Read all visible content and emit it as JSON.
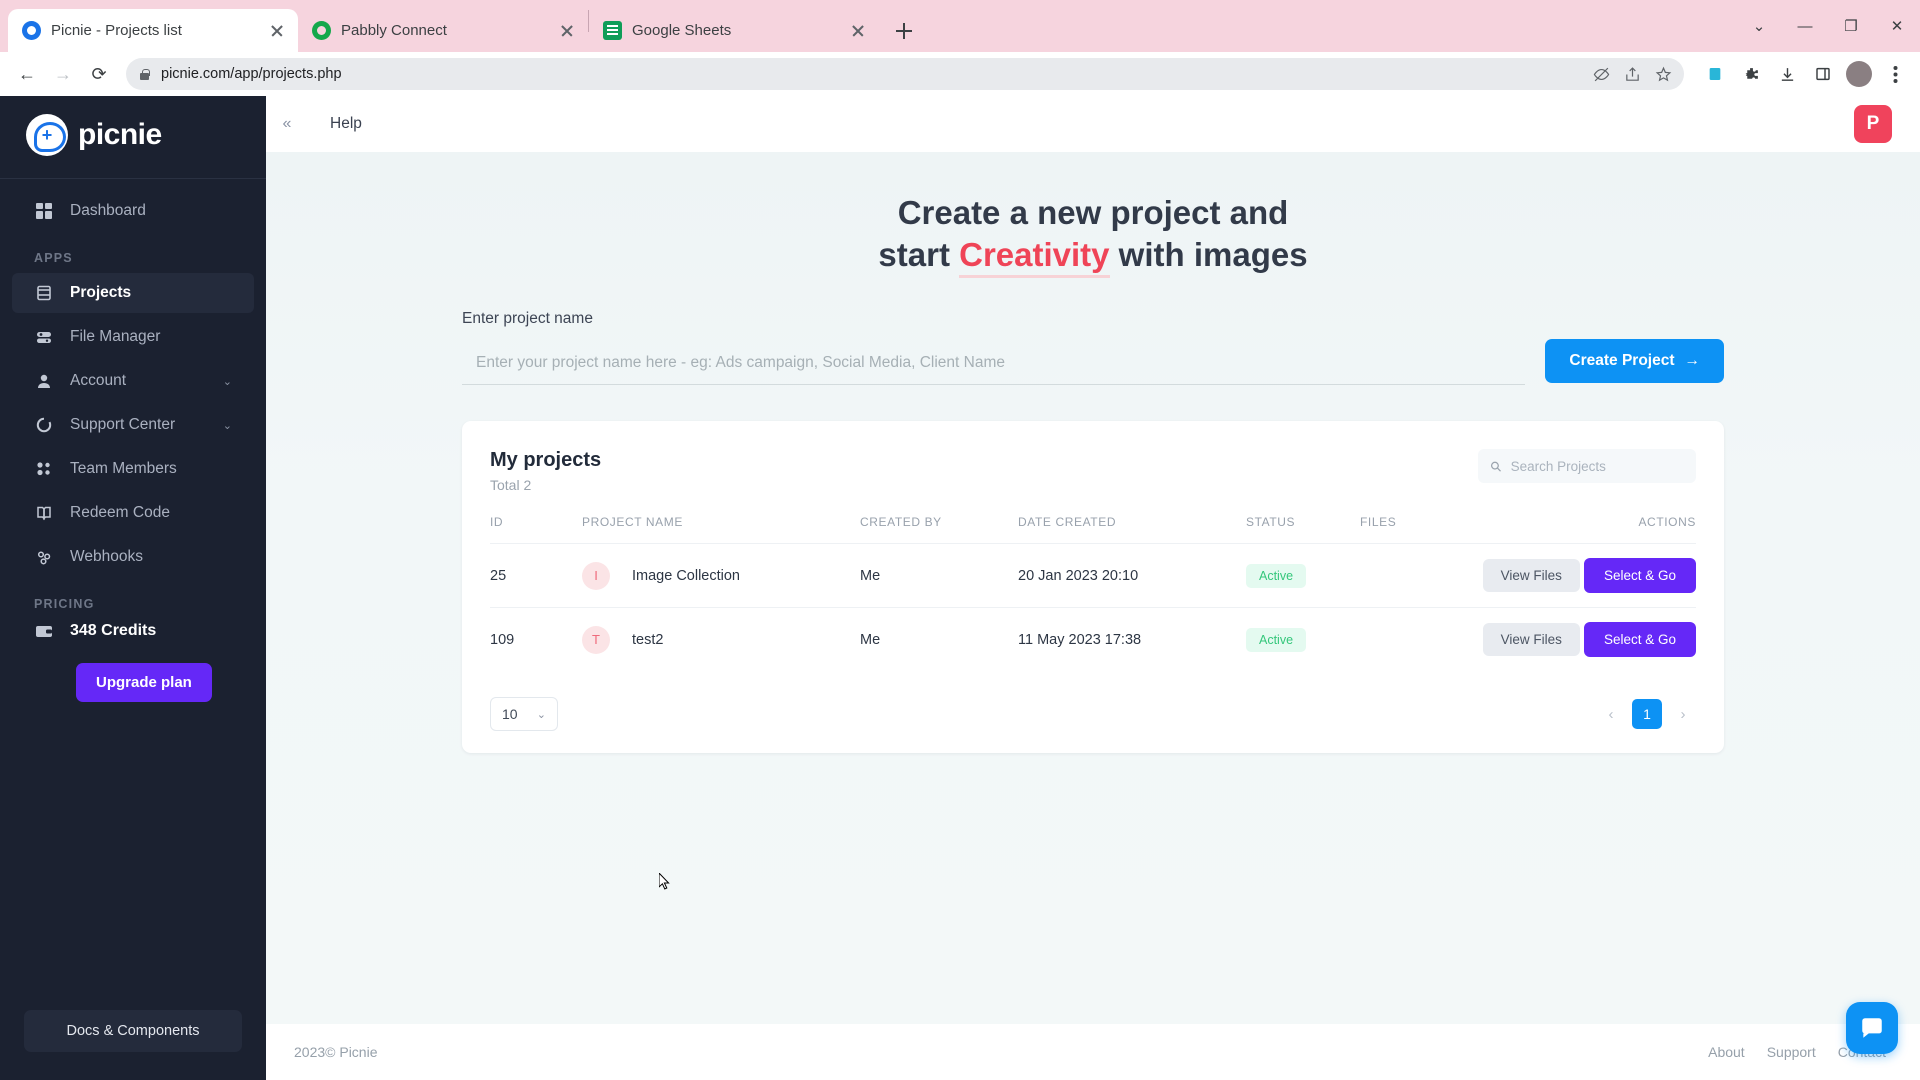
{
  "browser": {
    "tabs": [
      {
        "title": "Picnie - Projects list",
        "favicon": "picnie-icon",
        "active": true
      },
      {
        "title": "Pabbly Connect",
        "favicon": "pabbly-icon",
        "active": false
      },
      {
        "title": "Google Sheets",
        "favicon": "sheets-icon",
        "active": false
      }
    ],
    "new_tab_label": "+",
    "window_controls": {
      "dropdown": "⌄",
      "minimize": "—",
      "maximize": "❐",
      "close": "✕"
    },
    "nav": {
      "back": "←",
      "forward": "→",
      "reload": "⟳"
    },
    "url": "picnie.com/app/projects.php",
    "omnibox_icons": [
      "no-camera-icon",
      "share-icon",
      "star-icon"
    ],
    "toolbar_icons": [
      "extension-blue-icon",
      "puzzle-icon",
      "download-icon",
      "sidepanel-icon",
      "profile-avatar",
      "kebab-menu-icon"
    ]
  },
  "sidebar": {
    "logo_text": "picnie",
    "items": [
      {
        "label": "Dashboard",
        "icon": "grid-icon",
        "active": false,
        "chevron": ""
      },
      {
        "label": "Projects",
        "icon": "projects-icon",
        "active": true,
        "chevron": ""
      },
      {
        "label": "File Manager",
        "icon": "file-manager-icon",
        "active": false,
        "chevron": ""
      },
      {
        "label": "Account",
        "icon": "user-icon",
        "active": false,
        "chevron": "⌄"
      },
      {
        "label": "Support Center",
        "icon": "lifebuoy-icon",
        "active": false,
        "chevron": "⌄"
      },
      {
        "label": "Team Members",
        "icon": "team-icon",
        "active": false,
        "chevron": ""
      },
      {
        "label": "Redeem Code",
        "icon": "book-icon",
        "active": false,
        "chevron": ""
      },
      {
        "label": "Webhooks",
        "icon": "webhook-icon",
        "active": false,
        "chevron": ""
      }
    ],
    "apps_section_label": "APPS",
    "pricing_section_label": "PRICING",
    "credits_label": "348 Credits",
    "upgrade_label": "Upgrade plan",
    "docs_label": "Docs & Components"
  },
  "topbar": {
    "collapse_icon": "«",
    "help_label": "Help",
    "profile_initial": "P",
    "profile_color": "#f0435c"
  },
  "hero": {
    "line1": "Create a new project and",
    "line2_before": "start ",
    "line2_highlight": "Creativity",
    "line2_after": " with images",
    "highlight_color": "#ef4457"
  },
  "form": {
    "label": "Enter project name",
    "placeholder": "Enter your project name here - eg: Ads campaign, Social Media, Client Name",
    "value": "",
    "create_button": "Create Project",
    "create_button_arrow": "→",
    "create_button_color": "#0d92f4"
  },
  "projects_card": {
    "title": "My projects",
    "subtitle": "Total 2",
    "search_placeholder": "Search Projects",
    "search_value": "",
    "columns": [
      "ID",
      "PROJECT NAME",
      "CREATED BY",
      "DATE CREATED",
      "STATUS",
      "FILES",
      "ACTIONS"
    ],
    "rows": [
      {
        "id": "25",
        "avatar": "I",
        "name": "Image Collection",
        "created_by": "Me",
        "date_created": "20 Jan 2023 20:10",
        "status": "Active",
        "files_button": "View Files",
        "action_button": "Select & Go"
      },
      {
        "id": "109",
        "avatar": "T",
        "name": "test2",
        "created_by": "Me",
        "date_created": "11 May 2023 17:38",
        "status": "Active",
        "files_button": "View Files",
        "action_button": "Select & Go"
      }
    ],
    "per_page": "10",
    "per_page_chevron": "⌄",
    "pagination": {
      "prev": "‹",
      "current": "1",
      "next": "›"
    },
    "status_color": "#34c77b",
    "action_color": "#6528f7"
  },
  "footer": {
    "copyright": "2023©  Picnie",
    "links": [
      "About",
      "Support",
      "Contact"
    ]
  },
  "chat_widget": {
    "icon": "chat-icon"
  }
}
